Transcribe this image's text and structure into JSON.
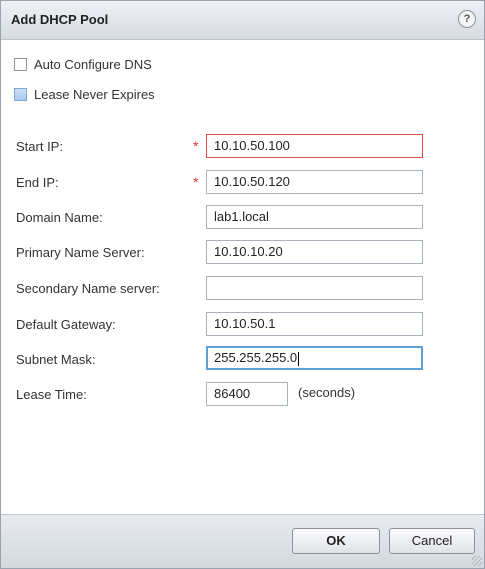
{
  "dialog": {
    "title": "Add DHCP Pool",
    "help_icon": "question-circle-icon",
    "help_glyph": "?"
  },
  "options": {
    "auto_configure_dns": {
      "label": "Auto Configure DNS",
      "checked": false
    },
    "lease_never_expires": {
      "label": "Lease Never Expires",
      "checked": false
    }
  },
  "form": {
    "start_ip": {
      "label": "Start IP:",
      "value": "10.10.50.100",
      "required": true
    },
    "end_ip": {
      "label": "End IP:",
      "value": "10.10.50.120",
      "required": true
    },
    "domain_name": {
      "label": "Domain Name:",
      "value": "lab1.local"
    },
    "primary_name_server": {
      "label": "Primary Name Server:",
      "value": "10.10.10.20"
    },
    "secondary_name_server": {
      "label": "Secondary Name server:",
      "value": ""
    },
    "default_gateway": {
      "label": "Default Gateway:",
      "value": "10.10.50.1"
    },
    "subnet_mask": {
      "label": "Subnet Mask:",
      "value": "255.255.255.0"
    },
    "lease_time": {
      "label": "Lease Time:",
      "value": "86400",
      "units": "(seconds)"
    },
    "required_marker": "*"
  },
  "footer": {
    "ok_label": "OK",
    "cancel_label": "Cancel"
  },
  "colors": {
    "error_border": "#e04d4d",
    "focus_border": "#5ea0d6",
    "required_marker": "#dd3333"
  }
}
